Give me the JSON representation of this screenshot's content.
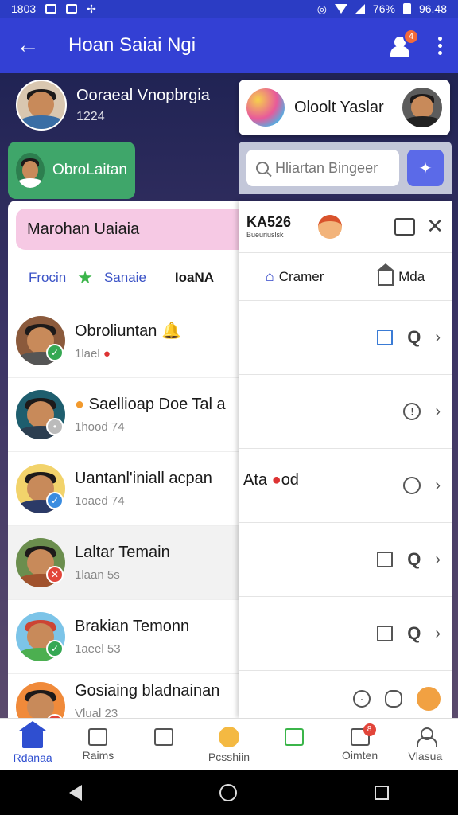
{
  "status_bar": {
    "time_left": "1803",
    "time_right": "96.48",
    "battery_text": "76%"
  },
  "app_bar": {
    "title": "Hoan Saiai Ngi",
    "badge": "4"
  },
  "top_user": {
    "name": "Ooraeal Vnopbrgia",
    "sub": "1224"
  },
  "green_chip": {
    "label": "ObroLaitan"
  },
  "top_card": {
    "title": "Oloolt Yaslar"
  },
  "search": {
    "placeholder": "Hliartan Bingeer"
  },
  "sheet": {
    "pink_title": "Marohan Uaiaia",
    "tabs": [
      "Frocin",
      "Sanaie",
      "IoaNA"
    ],
    "items": [
      {
        "title": "Obroliuntan",
        "meta": "1lael",
        "status_color": "#35a853"
      },
      {
        "title": "Saellioap Doe Tal a",
        "meta": "1hood 74",
        "status_color": "#bbbbbb"
      },
      {
        "title": "Uantanl'iniall acpan",
        "title_suffix": "Ata",
        "title_end": "od",
        "meta": "1oaed 74",
        "status_color": "#3a8ce0"
      },
      {
        "title": "Laltar Temain",
        "meta": "1laan 5s",
        "status_color": "#e2453a"
      },
      {
        "title": "Brakian Temonn",
        "meta": "1aeel 53",
        "status_color": "#35a853"
      },
      {
        "title": "Gosiaing bladnainan",
        "meta": "Vlual 23",
        "status_color": "#e2453a"
      }
    ]
  },
  "panel": {
    "code": "KA526",
    "code_sub": "Bueuriuslsk",
    "tabs": [
      "Cramer",
      "Mda"
    ]
  },
  "bottom_nav": {
    "items": [
      "Rdanaa",
      "Raims",
      "Pcsshiin",
      "Oimten",
      "Vlasua"
    ],
    "notif_badge": "8"
  }
}
